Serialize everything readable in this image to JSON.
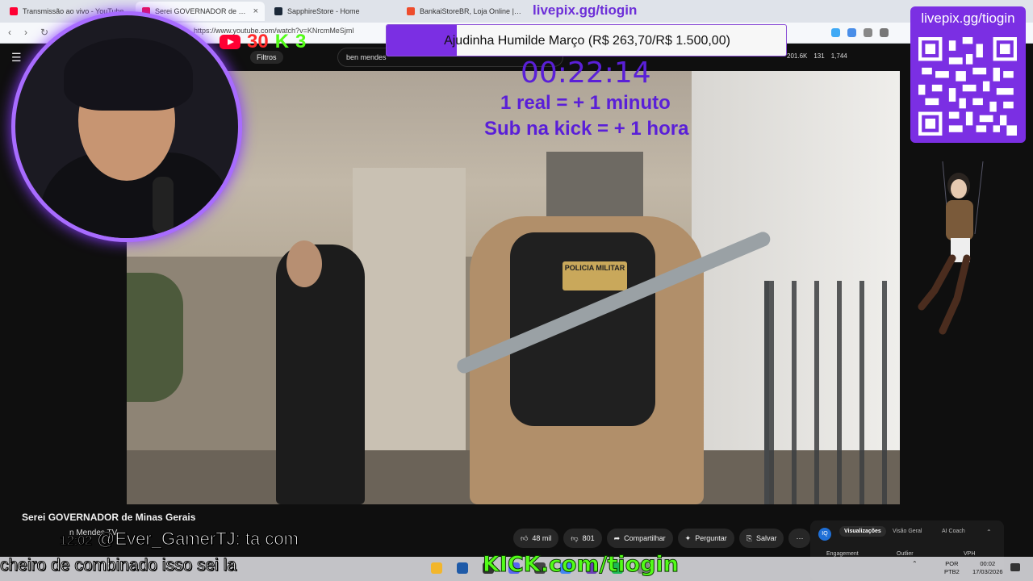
{
  "browser": {
    "tabs": [
      {
        "title": "Transmissão ao vivo - YouTube",
        "color": "#ff0033"
      },
      {
        "title": "Serei GOVERNADOR de Minas",
        "color": "#ff0033"
      },
      {
        "title": "SapphireStore - Home",
        "color": "#1b2838"
      },
      {
        "title": "BankaiStoreBR, Loja Online | Shopee",
        "color": "#ee4d2d"
      }
    ],
    "url": "https://www.youtube.com/watch?v=KNrcmMeSjml"
  },
  "youtube": {
    "filters_label": "Filtros",
    "search_value": "ben mendes",
    "stats": [
      "201.6K",
      "131",
      "1,744"
    ],
    "video_title": "Serei GOVERNADOR de Minas Gerais",
    "channel_name": "n Mendes TV",
    "actions": {
      "likes": "48 mil",
      "dislikes": "801",
      "share": "Compartilhar",
      "ask": "Perguntar",
      "save": "Salvar"
    },
    "vidiq_panel": {
      "badge": "IQ",
      "tabs": [
        "Visualizações",
        "Visão Geral",
        "AI Coach"
      ],
      "labels": [
        "Engagement",
        "Outlier",
        "VPH"
      ]
    }
  },
  "video": {
    "vest_text": "POLICIA MILITAR"
  },
  "overlay": {
    "livepix_top": "livepix.gg/tiogin",
    "goal": {
      "text": "Ajudinha Humilde Março (R$ 263,70/R$ 1.500,00)",
      "current": 263.7,
      "target": 1500.0
    },
    "timer": "00:22:14",
    "rule_1": "1 real = + 1 minuto",
    "rule_2": "Sub na kick = + 1 hora",
    "yt_count": "30",
    "kick_count": "3",
    "kick_letter": "K",
    "qr_title": "livepix.gg/tiogin",
    "chat_time": "12:02",
    "chat_line_1": "@Ever_GamerTJ: ta com",
    "chat_line_2": "cheiro de combinado isso sei la",
    "kick_url": "KICK.com/tiogin",
    "accent": "#7b2fe3",
    "kick_green": "#53fc18"
  },
  "taskbar": {
    "lang": [
      "POR",
      "PTB2"
    ],
    "time": "00:02",
    "date": "17/03/2026"
  }
}
